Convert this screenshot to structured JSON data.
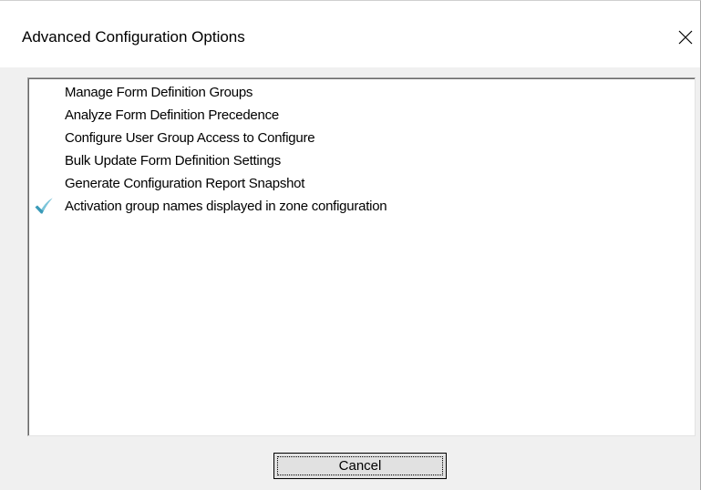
{
  "dialog": {
    "title": "Advanced Configuration Options",
    "close_icon": "close-icon"
  },
  "options": [
    {
      "label": "Manage Form Definition Groups",
      "checked": false
    },
    {
      "label": "Analyze Form Definition Precedence",
      "checked": false
    },
    {
      "label": "Configure User Group Access to Configure",
      "checked": false
    },
    {
      "label": "Bulk Update Form Definition Settings",
      "checked": false
    },
    {
      "label": "Generate Configuration Report Snapshot",
      "checked": false
    },
    {
      "label": "Activation group names displayed in zone configuration",
      "checked": true,
      "icon": "checkmark-icon"
    }
  ],
  "buttons": {
    "cancel_label": "Cancel"
  },
  "colors": {
    "window_bg": "#f0f0f0",
    "titlebar_bg": "#ffffff",
    "list_bg": "#ffffff",
    "button_bg": "#e1e1e1",
    "checkmark": "#3a9ab8"
  }
}
